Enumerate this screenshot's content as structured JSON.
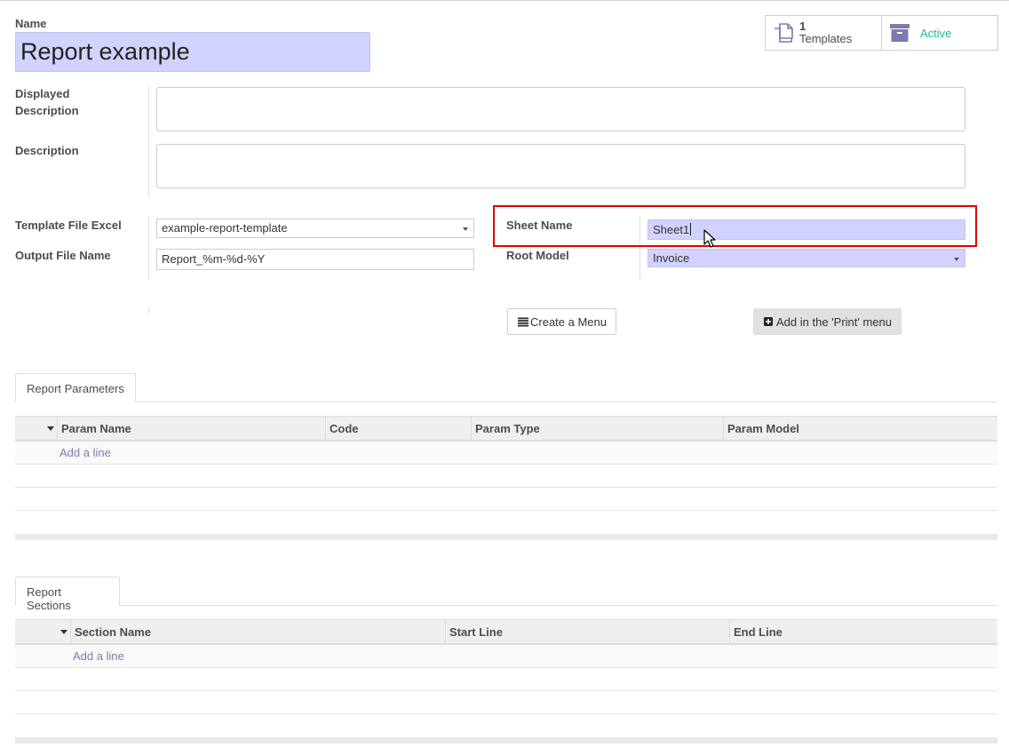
{
  "form": {
    "name_label": "Name",
    "name_value": "Report example",
    "displayed_description_label_1": "Displayed",
    "displayed_description_label_2": "Description",
    "description_label": "Description",
    "template_file_label": "Template File Excel",
    "template_file_value": "example-report-template",
    "output_file_label": "Output File Name",
    "output_file_value": "Report_%m-%d-%Y",
    "sheet_name_label": "Sheet Name",
    "sheet_name_value": "Sheet1",
    "root_model_label": "Root Model",
    "root_model_value": "Invoice"
  },
  "smart_buttons": {
    "templates_count": "1",
    "templates_label": "Templates",
    "active_label": "Active"
  },
  "actions": {
    "create_menu_label": "Create a Menu",
    "add_print_label": "Add in the 'Print' menu"
  },
  "parameters": {
    "tab_label": "Report Parameters",
    "columns": [
      "Param Name",
      "Code",
      "Param Type",
      "Param Model"
    ],
    "add_line": "Add a line"
  },
  "sections": {
    "tab_label": "Report Sections",
    "columns": [
      "Section Name",
      "Start Line",
      "End Line"
    ],
    "add_line": "Add a line"
  },
  "colors": {
    "highlight_field": "#d2d2ff",
    "active_green": "#21b799",
    "link_purple": "#7c7bad",
    "annotation_red": "#e00000"
  }
}
